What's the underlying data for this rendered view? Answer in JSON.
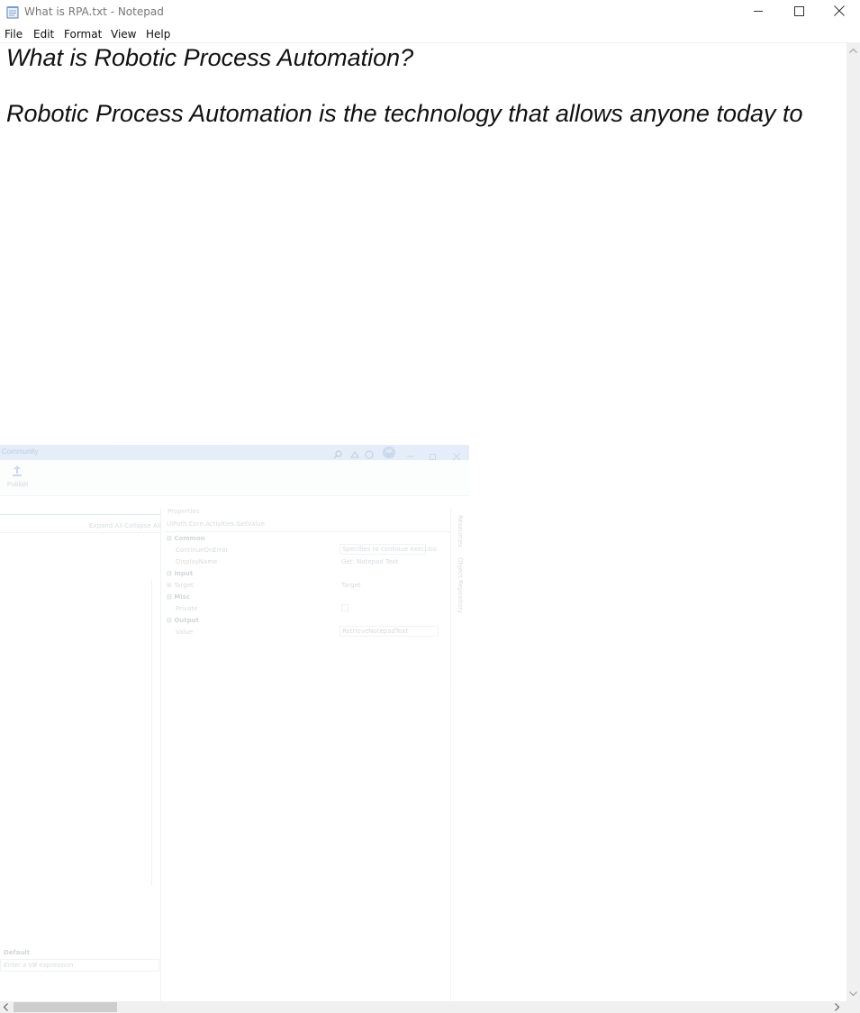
{
  "window": {
    "title": "What is RPA.txt - Notepad",
    "icons": {
      "app": "notepad-icon",
      "minimize": "minimize-icon",
      "maximize": "maximize-icon",
      "close": "close-icon"
    }
  },
  "menu": [
    "File",
    "Edit",
    "Format",
    "View",
    "Help"
  ],
  "editor": {
    "lines": [
      "What is Robotic Process Automation?",
      "Robotic Process Automation is the technology that allows anyone today to"
    ]
  },
  "overlay": {
    "title": "Community",
    "ribbon": {
      "publish": "Publish"
    },
    "outline": {
      "expand_all": "Expand All",
      "collapse_all": "Collapse All"
    },
    "properties": {
      "header": "Properties",
      "activity": "UiPath.Core.Activities.GetValue",
      "user_badge": "AK",
      "rows": [
        {
          "label": "Common",
          "type": "category"
        },
        {
          "label": "ContinueOnError",
          "value": "Specifies to continue executio",
          "type": "property"
        },
        {
          "label": "DisplayName",
          "value": "Get: Notepad Text",
          "type": "property"
        },
        {
          "label": "Input",
          "type": "category"
        },
        {
          "label": "Target",
          "value": "Target",
          "type": "property"
        },
        {
          "label": "Misc",
          "type": "category"
        },
        {
          "label": "Private",
          "value": "",
          "type": "checkbox"
        },
        {
          "label": "Output",
          "type": "category"
        },
        {
          "label": "Value",
          "value": "RetrieveNotepadText",
          "type": "property"
        }
      ]
    },
    "side_tabs": [
      "Resources",
      "Object Repository"
    ],
    "bottom": {
      "label": "Default",
      "placeholder": "Enter a VB expression"
    }
  }
}
